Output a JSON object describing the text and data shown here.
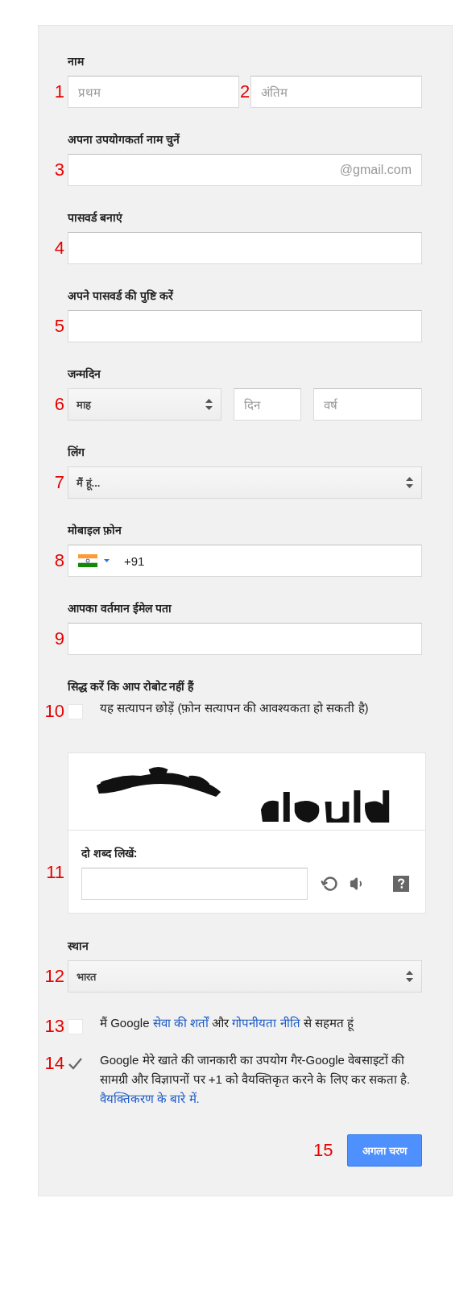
{
  "form": {
    "sections": [
      {
        "kind": "name",
        "label": "नाम",
        "fields": [
          {
            "marker": "1",
            "placeholder": "प्रथम"
          },
          {
            "marker": "2",
            "placeholder": "अंतिम"
          }
        ]
      },
      {
        "kind": "text",
        "label": "अपना उपयोगकर्ता नाम चुनें",
        "marker": "3",
        "suffix": "@gmail.com"
      },
      {
        "kind": "text",
        "label": "पासवर्ड बनाएं",
        "marker": "4"
      },
      {
        "kind": "text",
        "label": "अपने पासवर्ड की पुष्टि करें",
        "marker": "5"
      },
      {
        "kind": "birthday",
        "label": "जन्मदिन",
        "marker": "6",
        "month": "माह",
        "day_placeholder": "दिन",
        "year_placeholder": "वर्ष"
      },
      {
        "kind": "select",
        "label": "लिंग",
        "marker": "7",
        "value": "मैं हूं..."
      },
      {
        "kind": "phone",
        "label": "मोबाइल फ़ोन",
        "marker": "8",
        "value": "+91"
      },
      {
        "kind": "text",
        "label": "आपका वर्तमान ईमेल पता",
        "marker": "9"
      },
      {
        "kind": "robot",
        "label": "सिद्ध करें कि आप रोबोट नहीं हैं",
        "marker": "10",
        "checked": false,
        "text": "यह सत्यापन छोड़ें (फ़ोन सत्यापन की आवश्यकता हो सकती है)"
      },
      {
        "kind": "captcha",
        "marker": "11",
        "prompt": "दो शब्द लिखें:"
      },
      {
        "kind": "select",
        "label": "स्थान",
        "marker": "12",
        "value": "भारत"
      },
      {
        "kind": "agree",
        "marker": "13",
        "checked": false,
        "parts": [
          {
            "kind": "text",
            "text": "मैं Google "
          },
          {
            "kind": "link",
            "text": "सेवा की शर्तों"
          },
          {
            "kind": "text",
            "text": " और "
          },
          {
            "kind": "link",
            "text": "गोपनीयता नीति"
          },
          {
            "kind": "text",
            "text": " से सहमत हूं"
          }
        ]
      },
      {
        "kind": "agree",
        "marker": "14",
        "checked": true,
        "parts": [
          {
            "kind": "text",
            "text": "Google मेरे खाते की जानकारी का उपयोग गैर-Google वेबसाइटों की सामग्री और विज्ञापनों पर +1 को वैयक्तिकृत करने के लिए कर सकता है. "
          },
          {
            "kind": "link",
            "text": "वैयक्तिकरण के बारे में."
          }
        ]
      },
      {
        "kind": "button",
        "marker": "15",
        "label": "अगला चरण"
      }
    ]
  }
}
